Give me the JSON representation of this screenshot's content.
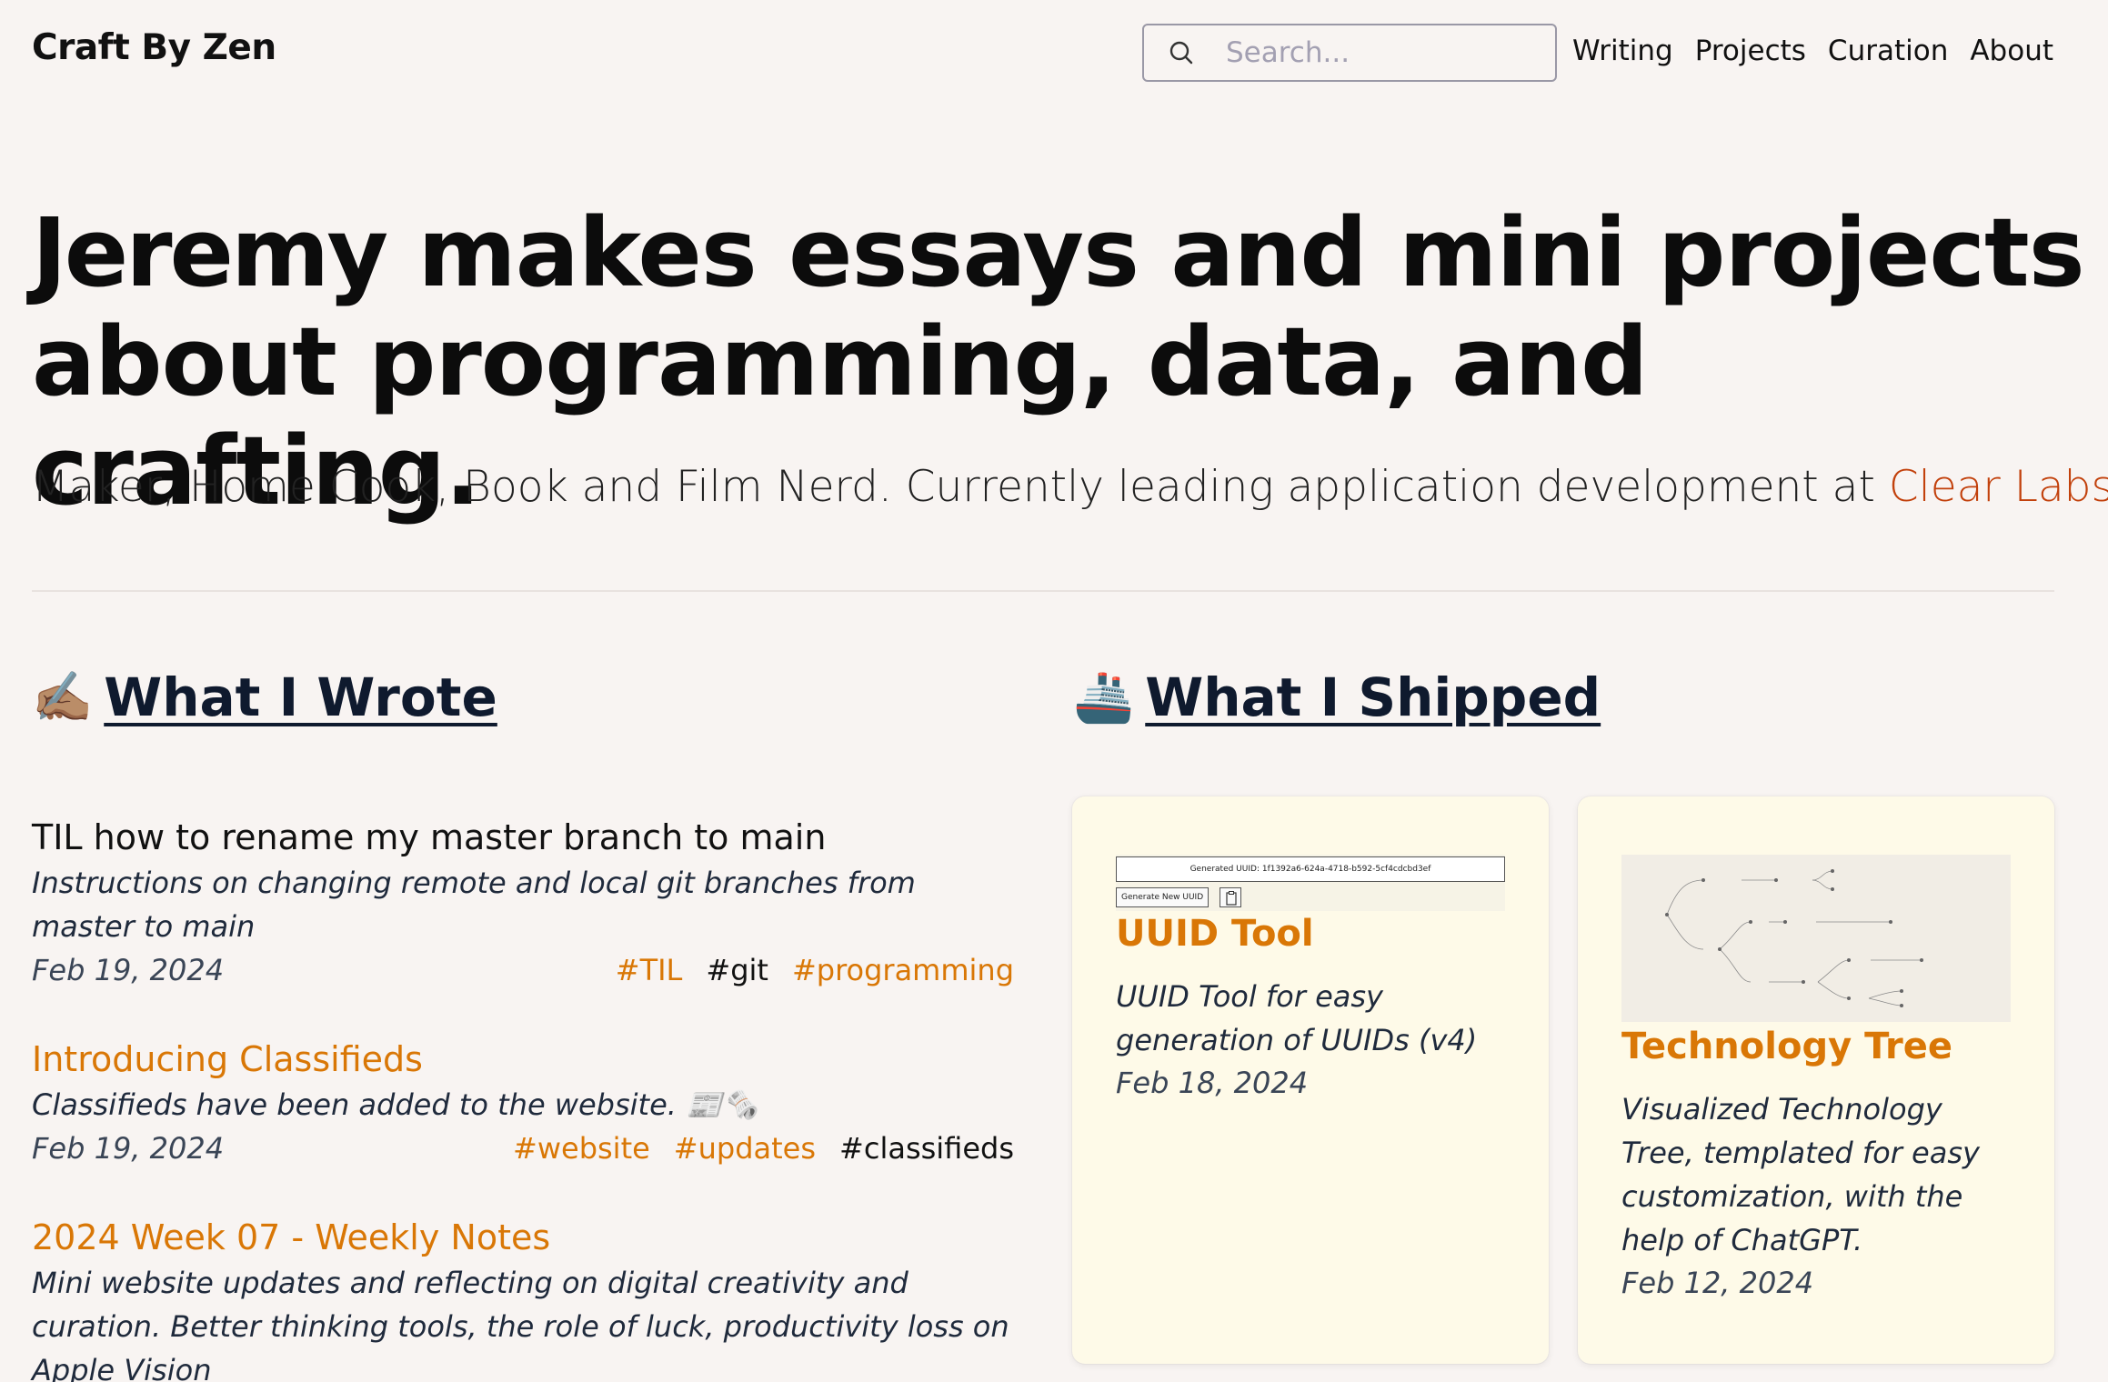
{
  "header": {
    "brand": "Craft By Zen",
    "search_placeholder": "Search...",
    "nav": [
      "Writing",
      "Projects",
      "Curation",
      "About"
    ]
  },
  "hero": {
    "name": "Jeremy",
    "title_rest": " makes essays and mini projects about programming, data, and crafting.",
    "subtitle": "Maker, Home Cook, Book and Film Nerd. Currently leading application development at ",
    "company_link": "Clear Labs"
  },
  "wrote": {
    "emoji": "✍🏽",
    "heading": "What I Wrote",
    "posts": [
      {
        "title": "TIL how to rename my master branch to main",
        "description": "Instructions on changing remote and local git branches from master to main",
        "date": "Feb 19, 2024",
        "tags": [
          "#TIL",
          "#git",
          "#programming"
        ]
      },
      {
        "title": "Introducing Classifieds",
        "description": "Classifieds have been added to the website. 📰🗞️",
        "date": "Feb 19, 2024",
        "tags": [
          "#website",
          "#updates",
          "#classifieds"
        ]
      },
      {
        "title": "2024 Week 07 - Weekly Notes",
        "description": "Mini website updates and reflecting on digital creativity and curation. Better thinking tools, the role of luck, productivity loss on Apple Vision"
      }
    ]
  },
  "shipped": {
    "emoji": "🚢",
    "heading": "What I Shipped",
    "projects": [
      {
        "title": "UUID Tool",
        "description": "UUID Tool for easy generation of UUIDs (v4)",
        "date": "Feb 18, 2024",
        "preview_uuid": "Generated UUID: 1f1392a6-624a-4718-b592-5cf4cdcbd3ef",
        "preview_button": "Generate New UUID"
      },
      {
        "title": "Technology Tree",
        "description": "Visualized Technology Tree, templated for easy customization, with the help of ChatGPT.",
        "date": "Feb 12, 2024"
      }
    ]
  },
  "colors": {
    "background": "#f8f4f2",
    "accent": "#d97706",
    "link": "#c2410c",
    "card": "#fefae8"
  },
  "icons": {
    "search": "search-icon"
  }
}
